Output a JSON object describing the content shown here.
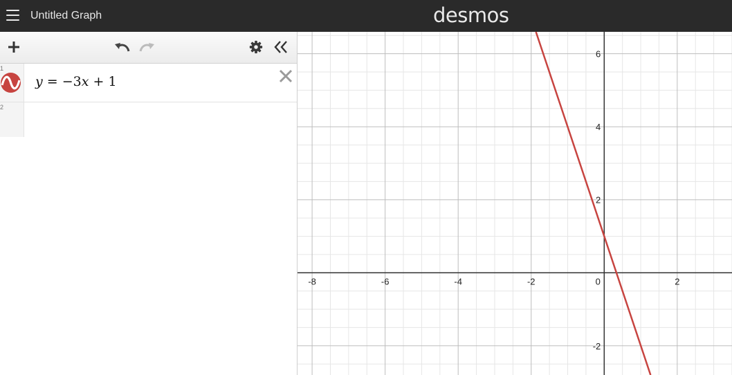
{
  "header": {
    "title": "Untitled Graph",
    "brand": "desmos",
    "menu_icon": "hamburger-icon"
  },
  "toolbar": {
    "add_icon": "plus-icon",
    "undo_icon": "undo-icon",
    "redo_icon": "redo-icon",
    "settings_icon": "gear-icon",
    "collapse_icon": "double-chevron-left-icon"
  },
  "expressions": [
    {
      "number": "1",
      "latex": "y = -3x + 1",
      "color": "#c74440",
      "icon": "sine-wave-icon"
    },
    {
      "number": "2",
      "latex": ""
    }
  ],
  "graph": {
    "x_range": [
      -8.4,
      3.5
    ],
    "y_range": [
      -2.8,
      6.6
    ],
    "grid": true,
    "x_tick_labels": [
      "-8",
      "-6",
      "-4",
      "-2",
      "0",
      "2"
    ],
    "y_tick_labels": [
      "6",
      "4",
      "2",
      "-2"
    ],
    "line_color": "#c74440"
  },
  "chart_data": {
    "type": "line",
    "title": "",
    "xlabel": "",
    "ylabel": "",
    "xlim": [
      -8.4,
      3.5
    ],
    "ylim": [
      -2.8,
      6.6
    ],
    "x_ticks": [
      -8,
      -6,
      -4,
      -2,
      0,
      2
    ],
    "y_ticks": [
      -2,
      2,
      4,
      6
    ],
    "series": [
      {
        "slope": -3,
        "intercept": 1,
        "x": [
          -1.87,
          1.27
        ],
        "y": [
          6.6,
          -2.8
        ],
        "color": "#c74440"
      }
    ]
  }
}
